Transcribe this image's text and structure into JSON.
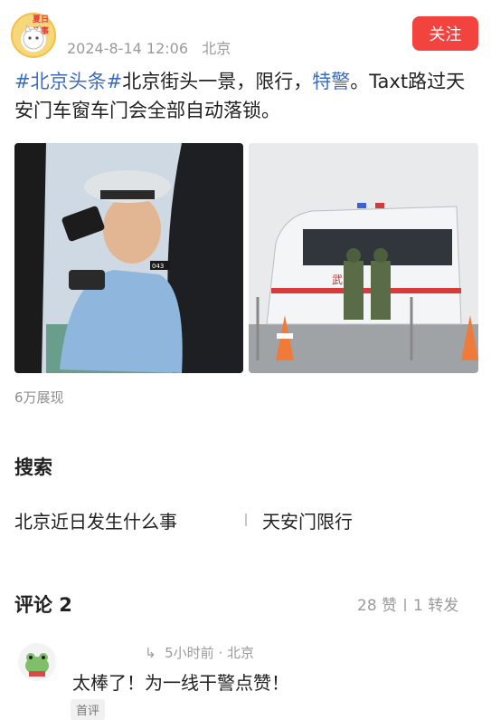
{
  "header": {
    "avatar_badge": "夏日记事",
    "date": "2024-8-14 12:06",
    "location": "北京",
    "follow_label": "关注"
  },
  "post": {
    "tag1": "#北京头条#",
    "text1": "北京街头一景，限行，",
    "link": "特警",
    "text2": "。Taxt路过天安门车窗车门会全部自动落锁。"
  },
  "images": {
    "image1_label": "043",
    "image2_label": "武"
  },
  "stats": {
    "views": "6万展现"
  },
  "search": {
    "title": "搜索",
    "items": [
      "北京近日发生什么事",
      "天安门限行"
    ]
  },
  "comments": {
    "title": "评论 2",
    "likes": "28 赞",
    "reposts": "1 转发",
    "items": [
      {
        "time": "5小时前",
        "location": "北京",
        "text": "太棒了！为一线干警点赞！",
        "badge": "首评"
      }
    ]
  },
  "colors": {
    "accent": "#f2433e",
    "link": "#3d6dbe"
  }
}
